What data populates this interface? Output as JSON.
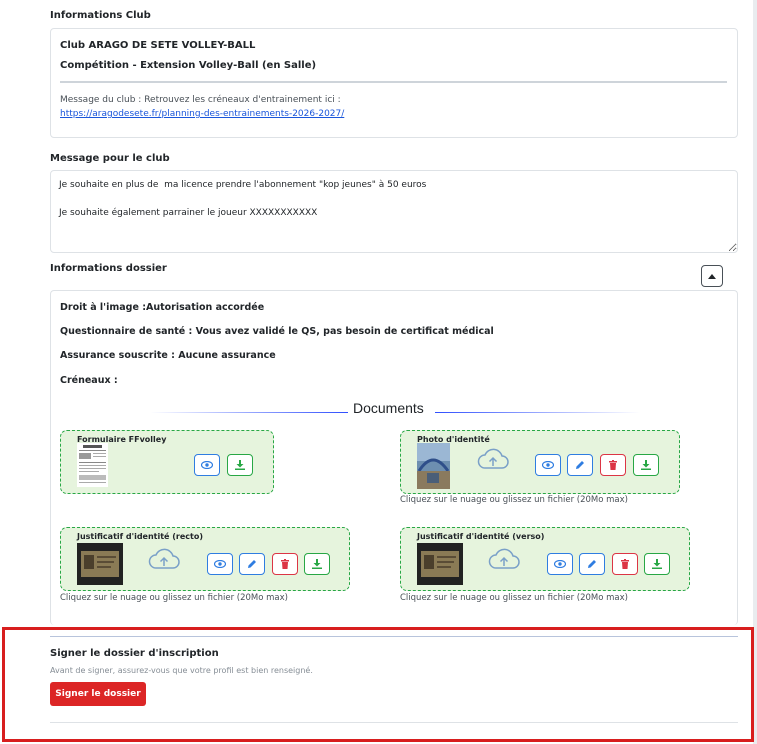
{
  "club_info": {
    "label": "Informations Club",
    "club_name": "Club ARAGO DE SETE VOLLEY-BALL",
    "competition": "Compétition - Extension Volley-Ball (en Salle)",
    "message_prefix": "Message du club : Retrouvez les créneaux d'entrainement ici :",
    "message_link": "https://aragodesete.fr/planning-des-entrainements-2026-2027/"
  },
  "club_message": {
    "label": "Message pour le club",
    "value": "Je souhaite en plus de  ma licence prendre l'abonnement \"kop jeunes\" à 50 euros\n\nJe souhaite également parrainer le joueur XXXXXXXXXXX"
  },
  "dossier": {
    "label": "Informations dossier",
    "image_rights": "Droit à l'image :Autorisation accordée",
    "health": "Questionnaire de santé : Vous avez validé le QS, pas besoin de certificat médical",
    "insurance": "Assurance souscrite : Aucune assurance",
    "slots": "Créneaux :"
  },
  "documents": {
    "title": "Documents",
    "help_text": "Cliquez sur le nuage ou glissez un fichier (20Mo max)",
    "items": [
      {
        "name": "Formulaire FFvolley"
      },
      {
        "name": "Photo d'identité"
      },
      {
        "name": "Justificatif d'identité (recto)"
      },
      {
        "name": "Justificatif d'identité (verso)"
      }
    ]
  },
  "signature": {
    "title": "Signer le dossier d'inscription",
    "subtitle": "Avant de signer, assurez-vous que votre profil est bien renseigné.",
    "button": "Signer le dossier"
  },
  "colors": {
    "accent_red": "#dc2626",
    "doc_border": "#28a745",
    "doc_bg": "#e6f4dd",
    "link": "#1a56db"
  }
}
